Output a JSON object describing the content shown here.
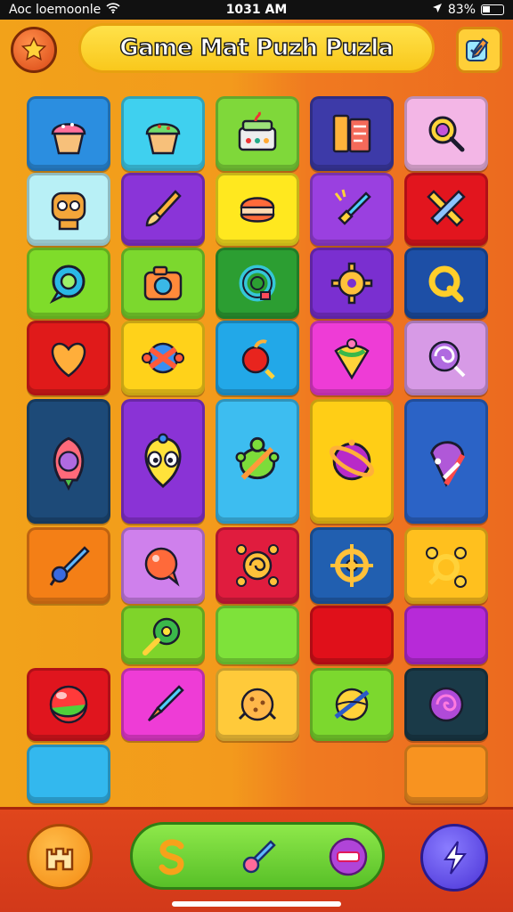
{
  "status_bar": {
    "carrier": "Aoc loemoonle",
    "time": "1031 AM",
    "battery": "83%"
  },
  "header": {
    "title": "Game Mat Puzh Puzla",
    "left_button_icon": "star-icon",
    "right_button_icon": "pencil-check-icon"
  },
  "tiles": [
    {
      "icon": "cupcake-pink-icon",
      "color": "#2b8ee0"
    },
    {
      "icon": "cupcake-green-icon",
      "color": "#3fd0ef"
    },
    {
      "icon": "cake-box-icon",
      "color": "#7fd83a"
    },
    {
      "icon": "books-icon",
      "color": "#3d3aa8"
    },
    {
      "icon": "magnifier-icon",
      "color": "#f3b6e6"
    },
    {
      "icon": "robot-face-icon",
      "color": "#b8f0f6"
    },
    {
      "icon": "paintbrush-icon",
      "color": "#8a34d8"
    },
    {
      "icon": "macaron-icon",
      "color": "#ffe81f"
    },
    {
      "icon": "rocket-pen-icon",
      "color": "#9a40e0"
    },
    {
      "icon": "crossed-tools-icon",
      "color": "#e2151e"
    },
    {
      "icon": "speech-ring-icon",
      "color": "#7fdc2a"
    },
    {
      "icon": "camera-icon",
      "color": "#7cd82e"
    },
    {
      "icon": "ring-donut-icon",
      "color": "#2c9e32"
    },
    {
      "icon": "gear-icon",
      "color": "#7a2fd0"
    },
    {
      "icon": "letter-q-icon",
      "color": "#1d4fa6"
    },
    {
      "icon": "heart-icon",
      "color": "#e01a1a"
    },
    {
      "icon": "ball-knot-icon",
      "color": "#ffd21a"
    },
    {
      "icon": "candy-apple-icon",
      "color": "#22a8e8"
    },
    {
      "icon": "spinning-top-icon",
      "color": "#ee3cd6"
    },
    {
      "icon": "lollipop-icon",
      "color": "#d79ae6"
    },
    {
      "icon": "pepper-shell-icon",
      "color": "#1d4a78"
    },
    {
      "icon": "yellow-creature-icon",
      "color": "#8a33d6"
    },
    {
      "icon": "turtle-icon",
      "color": "#3dbdf0"
    },
    {
      "icon": "purple-ball-icon",
      "color": "#ffce16"
    },
    {
      "icon": "striped-candy-icon",
      "color": "#2b63c6"
    },
    {
      "icon": "rocket-icon",
      "color": "#f47f16"
    },
    {
      "icon": "bubble-icon",
      "color": "#cf80ec"
    },
    {
      "icon": "spiral-gear-icon",
      "color": "#e01c3e"
    },
    {
      "icon": "ship-wheel-icon",
      "color": "#215fb0"
    },
    {
      "icon": "cog-cluster-icon",
      "color": "#ffc01e"
    },
    {
      "icon": "key-ring-icon",
      "color": "#7fd42a"
    },
    {
      "icon": "blank-tile",
      "color": "#7ee23a"
    },
    {
      "icon": "blank-tile",
      "color": "#e0101a"
    },
    {
      "icon": "blank-tile",
      "color": "#b72ad8"
    },
    {
      "icon": "ball-icon",
      "color": "#e0151e"
    },
    {
      "icon": "dart-icon",
      "color": "#ee3cd6"
    },
    {
      "icon": "cookie-icon",
      "color": "#ffca3a"
    },
    {
      "icon": "striped-ball-icon",
      "color": "#7cd82e"
    },
    {
      "icon": "swirl-icon",
      "color": "#1a3a48"
    },
    {
      "icon": "blank-tile",
      "color": "#33b8ee"
    },
    {
      "icon": "blank-tile",
      "color": "#f89320"
    }
  ],
  "bottom_bar": {
    "left_icon": "castle-icon",
    "center_icons": [
      "letter-s-icon",
      "rocket-icon",
      "minus-badge-icon"
    ],
    "right_icon": "lightning-icon"
  }
}
